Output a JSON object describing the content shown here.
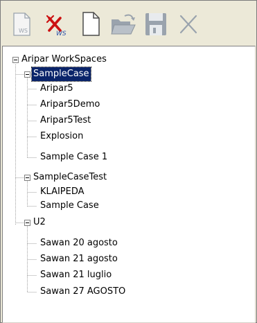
{
  "toolbar": {
    "buttons": [
      {
        "name": "new-workspace-button",
        "icon": "ws-document-icon",
        "label": "WS"
      },
      {
        "name": "delete-workspace-button",
        "icon": "delete-ws-icon",
        "label": "WS"
      },
      {
        "name": "new-case-button",
        "icon": "new-document-icon"
      },
      {
        "name": "open-button",
        "icon": "open-folder-icon"
      },
      {
        "name": "save-button",
        "icon": "floppy-disk-icon"
      },
      {
        "name": "close-button",
        "icon": "close-x-icon"
      }
    ]
  },
  "tree": {
    "root": {
      "label": "Aripar WorkSpaces",
      "expanded": true,
      "children": [
        {
          "label": "SampleCase",
          "expanded": true,
          "selected": true,
          "children": [
            "Aripar5",
            "Aripar5Demo",
            "Aripar5Test",
            "Explosion",
            "Sample Case 1"
          ]
        },
        {
          "label": "SampleCaseTest",
          "expanded": true,
          "children": [
            "KLAIPEDA",
            "Sample Case"
          ]
        },
        {
          "label": "U2",
          "expanded": true,
          "children": [
            "Sawan 20 agosto",
            "Sawan 21 agosto",
            "Sawan 21 luglio",
            "Sawan 27 AGOSTO"
          ]
        }
      ]
    }
  },
  "colors": {
    "toolbar_bg": "#ece9d8",
    "selection_bg": "#0a246a",
    "selection_fg": "#ffffff",
    "delete_red": "#cc1111",
    "ws_blue": "#2a4fa8",
    "icon_gray": "#9aa3ad"
  }
}
